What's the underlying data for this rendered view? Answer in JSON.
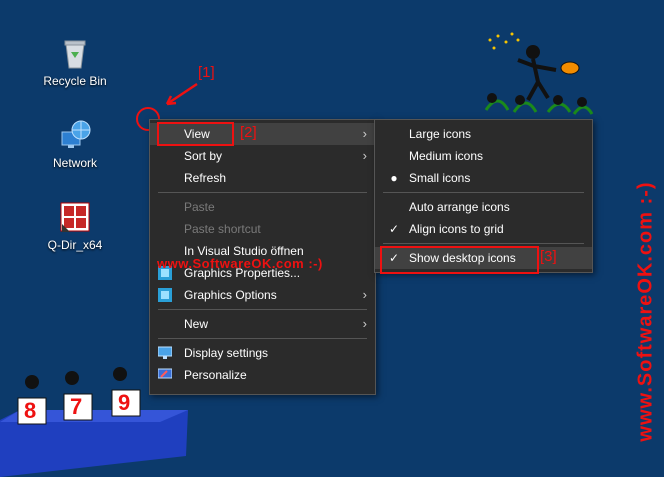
{
  "desktop": {
    "icons": [
      {
        "label": "Recycle Bin",
        "icon": "recycle-bin-icon"
      },
      {
        "label": "Network",
        "icon": "network-icon"
      },
      {
        "label": "Q-Dir_x64",
        "icon": "qdir-icon"
      }
    ]
  },
  "annotations": {
    "a1": "[1]",
    "a2": "[2]",
    "a3": "[3]",
    "watermark_side": "www.SoftwareOK.com :-)",
    "watermark_mid": "www.SoftwareOK.com :-)"
  },
  "context_menu": {
    "items": [
      {
        "label": "View",
        "submenu": true
      },
      {
        "label": "Sort by",
        "submenu": true
      },
      {
        "label": "Refresh"
      },
      {
        "label": "Paste",
        "disabled": true
      },
      {
        "label": "Paste shortcut",
        "disabled": true
      },
      {
        "label": "In Visual Studio öffnen"
      },
      {
        "label": "Graphics Properties..."
      },
      {
        "label": "Graphics Options",
        "submenu": true
      },
      {
        "label": "New",
        "submenu": true
      },
      {
        "label": "Display settings"
      },
      {
        "label": "Personalize"
      }
    ]
  },
  "view_submenu": {
    "items": [
      {
        "label": "Large icons"
      },
      {
        "label": "Medium icons"
      },
      {
        "label": "Small icons",
        "selected": "radio"
      },
      {
        "label": "Auto arrange icons"
      },
      {
        "label": "Align icons to grid",
        "checked": true
      },
      {
        "label": "Show desktop icons",
        "checked": true
      }
    ]
  },
  "cards": [
    "8",
    "7",
    "9"
  ],
  "colors": {
    "desktop": "#0c3a6b",
    "menu": "#2b2b2b",
    "highlight": "#414141",
    "annotation": "#e11111"
  }
}
